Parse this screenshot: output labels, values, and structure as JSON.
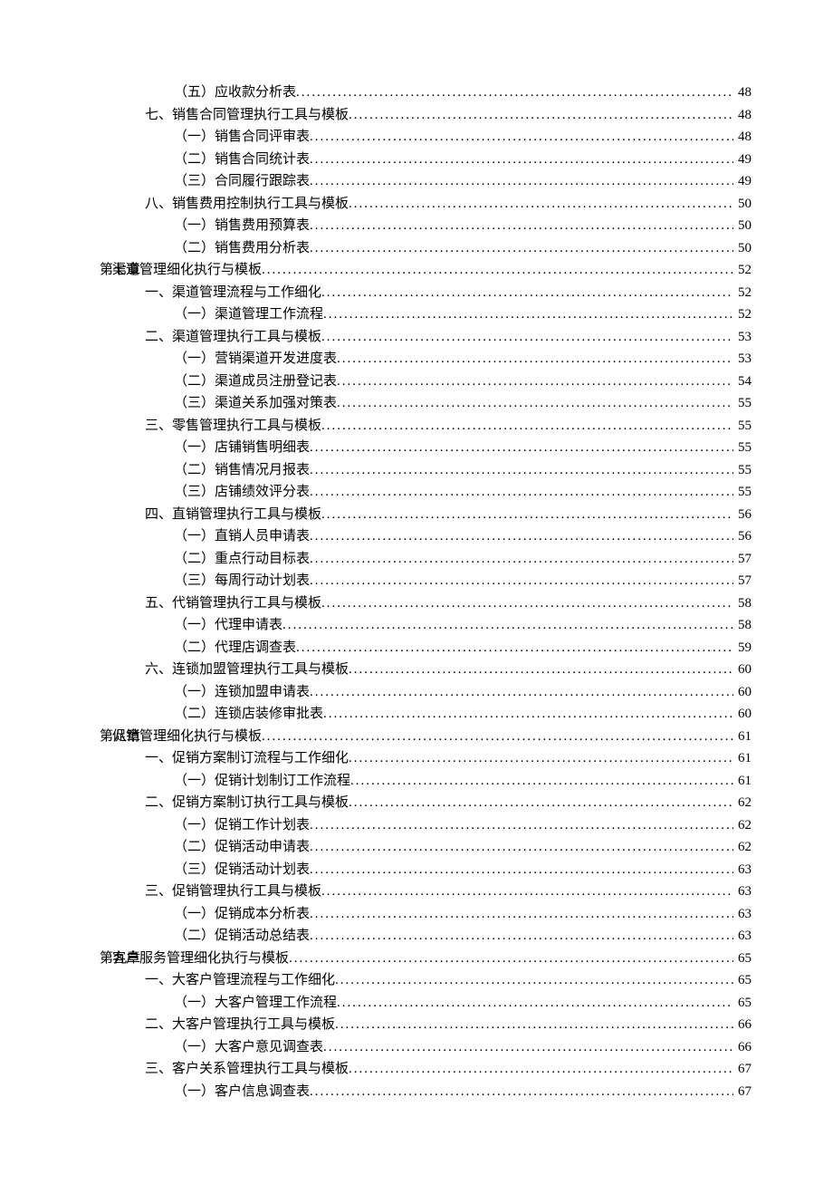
{
  "dots": "....................................................................................................................................................................",
  "entries": [
    {
      "level": 2,
      "text": "（五）应收款分析表",
      "page": "48"
    },
    {
      "level": 1,
      "text": "七、销售合同管理执行工具与模板",
      "page": "48"
    },
    {
      "level": 2,
      "text": "（一）销售合同评审表",
      "page": "48"
    },
    {
      "level": 2,
      "text": "（二）销售合同统计表",
      "page": "49"
    },
    {
      "level": 2,
      "text": "（三）合同履行跟踪表",
      "page": "49"
    },
    {
      "level": 1,
      "text": "八、销售费用控制执行工具与模板",
      "page": "50"
    },
    {
      "level": 2,
      "text": "（一）销售费用预算表",
      "page": "50"
    },
    {
      "level": 2,
      "text": "（二）销售费用分析表",
      "page": "50"
    },
    {
      "level": 0,
      "chapter": "第七章",
      "text": "渠道管理细化执行与模板",
      "page": "52"
    },
    {
      "level": 1,
      "text": "一、渠道管理流程与工作细化",
      "page": "52"
    },
    {
      "level": 2,
      "text": "（一）渠道管理工作流程",
      "page": "52"
    },
    {
      "level": 1,
      "text": "二、渠道管理执行工具与模板",
      "page": "53"
    },
    {
      "level": 2,
      "text": "（一）营销渠道开发进度表",
      "page": "53"
    },
    {
      "level": 2,
      "text": "（二）渠道成员注册登记表",
      "page": "54"
    },
    {
      "level": 2,
      "text": "（三）渠道关系加强对策表",
      "page": "55"
    },
    {
      "level": 1,
      "text": "三、零售管理执行工具与模板",
      "page": "55"
    },
    {
      "level": 2,
      "text": "（一）店铺销售明细表",
      "page": "55"
    },
    {
      "level": 2,
      "text": "（二）销售情况月报表",
      "page": "55"
    },
    {
      "level": 2,
      "text": "（三）店铺绩效评分表",
      "page": "55"
    },
    {
      "level": 1,
      "text": "四、直销管理执行工具与模板",
      "page": "56"
    },
    {
      "level": 2,
      "text": "（一）直销人员申请表",
      "page": "56"
    },
    {
      "level": 2,
      "text": "（二）重点行动目标表",
      "page": "57"
    },
    {
      "level": 2,
      "text": "（三）每周行动计划表",
      "page": "57"
    },
    {
      "level": 1,
      "text": "五、代销管理执行工具与模板",
      "page": "58"
    },
    {
      "level": 2,
      "text": "（一）代理申请表",
      "page": "58"
    },
    {
      "level": 2,
      "text": "（二）代理店调查表",
      "page": "59"
    },
    {
      "level": 1,
      "text": "六、连锁加盟管理执行工具与模板",
      "page": "60"
    },
    {
      "level": 2,
      "text": "（一）连锁加盟申请表",
      "page": "60"
    },
    {
      "level": 2,
      "text": "（二）连锁店装修审批表",
      "page": "60"
    },
    {
      "level": 0,
      "chapter": "第八章",
      "text": "促销管理细化执行与模板",
      "page": "61"
    },
    {
      "level": 1,
      "text": "一、促销方案制订流程与工作细化",
      "page": "61"
    },
    {
      "level": 2,
      "text": "（一）促销计划制订工作流程",
      "page": "61"
    },
    {
      "level": 1,
      "text": "二、促销方案制订执行工具与模板",
      "page": "62"
    },
    {
      "level": 2,
      "text": "（一）促销工作计划表",
      "page": "62"
    },
    {
      "level": 2,
      "text": "（二）促销活动申请表",
      "page": "62"
    },
    {
      "level": 2,
      "text": "（三）促销活动计划表",
      "page": "63"
    },
    {
      "level": 1,
      "text": "三、促销管理执行工具与模板",
      "page": "63"
    },
    {
      "level": 2,
      "text": "（一）促销成本分析表",
      "page": "63"
    },
    {
      "level": 2,
      "text": "（二）促销活动总结表",
      "page": "63"
    },
    {
      "level": 0,
      "chapter": "第九章",
      "text": "客户服务管理细化执行与模板",
      "page": "65"
    },
    {
      "level": 1,
      "text": "一、大客户管理流程与工作细化",
      "page": "65"
    },
    {
      "level": 2,
      "text": "（一）大客户管理工作流程",
      "page": "65"
    },
    {
      "level": 1,
      "text": "二、大客户管理执行工具与模板",
      "page": "66"
    },
    {
      "level": 2,
      "text": "（一）大客户意见调查表",
      "page": "66"
    },
    {
      "level": 1,
      "text": "三、客户关系管理执行工具与模板",
      "page": "67"
    },
    {
      "level": 2,
      "text": "（一）客户信息调查表",
      "page": "67"
    }
  ]
}
